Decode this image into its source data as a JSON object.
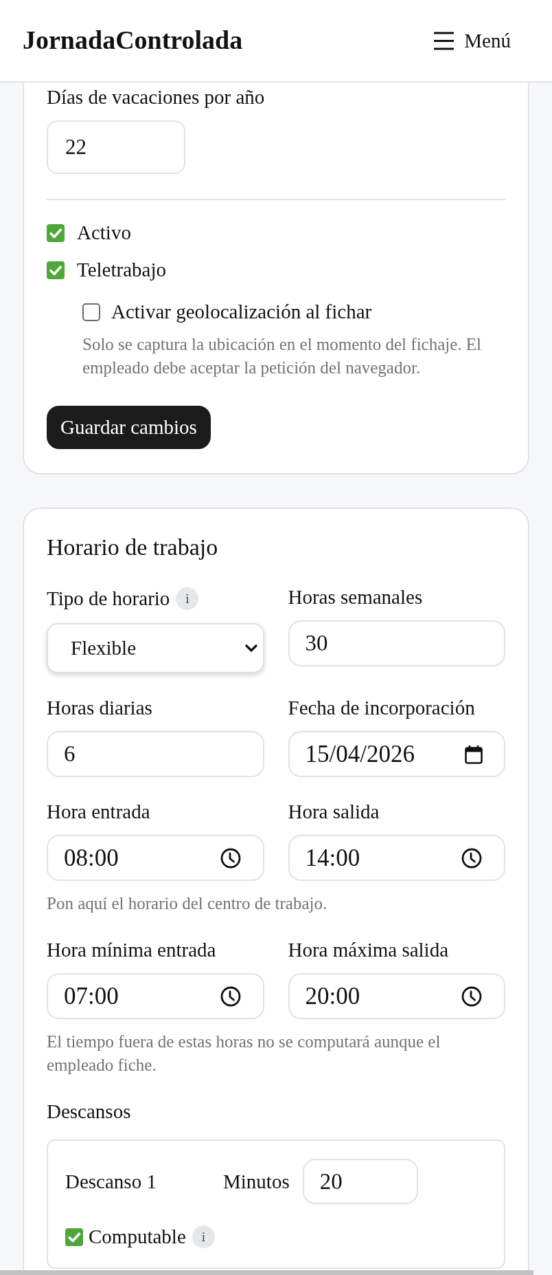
{
  "header": {
    "brand": "JornadaControlada",
    "menu_label": "Menú"
  },
  "employee_card": {
    "vacation": {
      "label": "Días de vacaciones por año",
      "value": "22"
    },
    "options": [
      {
        "label": "Activo",
        "checked": true
      },
      {
        "label": "Teletrabajo",
        "checked": true,
        "children": [
          {
            "label": "Activar geolocalización al fichar",
            "checked": false,
            "hint": "Solo se captura la ubicación en el momento del fichaje. El empleado debe aceptar la petición del navegador."
          }
        ]
      }
    ],
    "save_button": "Guardar cambios"
  },
  "schedule_card": {
    "title": "Horario de trabajo",
    "rows": [
      {
        "fields": [
          {
            "kind": "select",
            "label": "Tipo de horario",
            "info_badge": "i",
            "value": "Flexible"
          },
          {
            "kind": "number",
            "label": "Horas semanales",
            "value": "30"
          }
        ]
      },
      {
        "fields": [
          {
            "kind": "number",
            "label": "Horas diarias",
            "value": "6"
          },
          {
            "kind": "date",
            "label": "Fecha de incorporación",
            "value": "15/04/2026"
          }
        ]
      },
      {
        "fields": [
          {
            "kind": "time",
            "label": "Hora entrada",
            "value": "08:00"
          },
          {
            "kind": "time",
            "label": "Hora salida",
            "value": "14:00"
          }
        ],
        "hint": "Pon aquí el horario del centro de trabajo."
      },
      {
        "fields": [
          {
            "kind": "time",
            "label": "Hora mínima entrada",
            "value": "07:00"
          },
          {
            "kind": "time",
            "label": "Hora máxima salida",
            "value": "20:00"
          }
        ],
        "hint": "El tiempo fuera de estas horas no se computará aunque el empleado fiche."
      }
    ],
    "breaks": {
      "title": "Descansos",
      "items": [
        {
          "name": "Descanso 1",
          "minutes_label": "Minutos",
          "minutes": "20",
          "computable": {
            "label": "Computable",
            "checked": true,
            "info_badge": "i"
          }
        }
      ]
    }
  }
}
